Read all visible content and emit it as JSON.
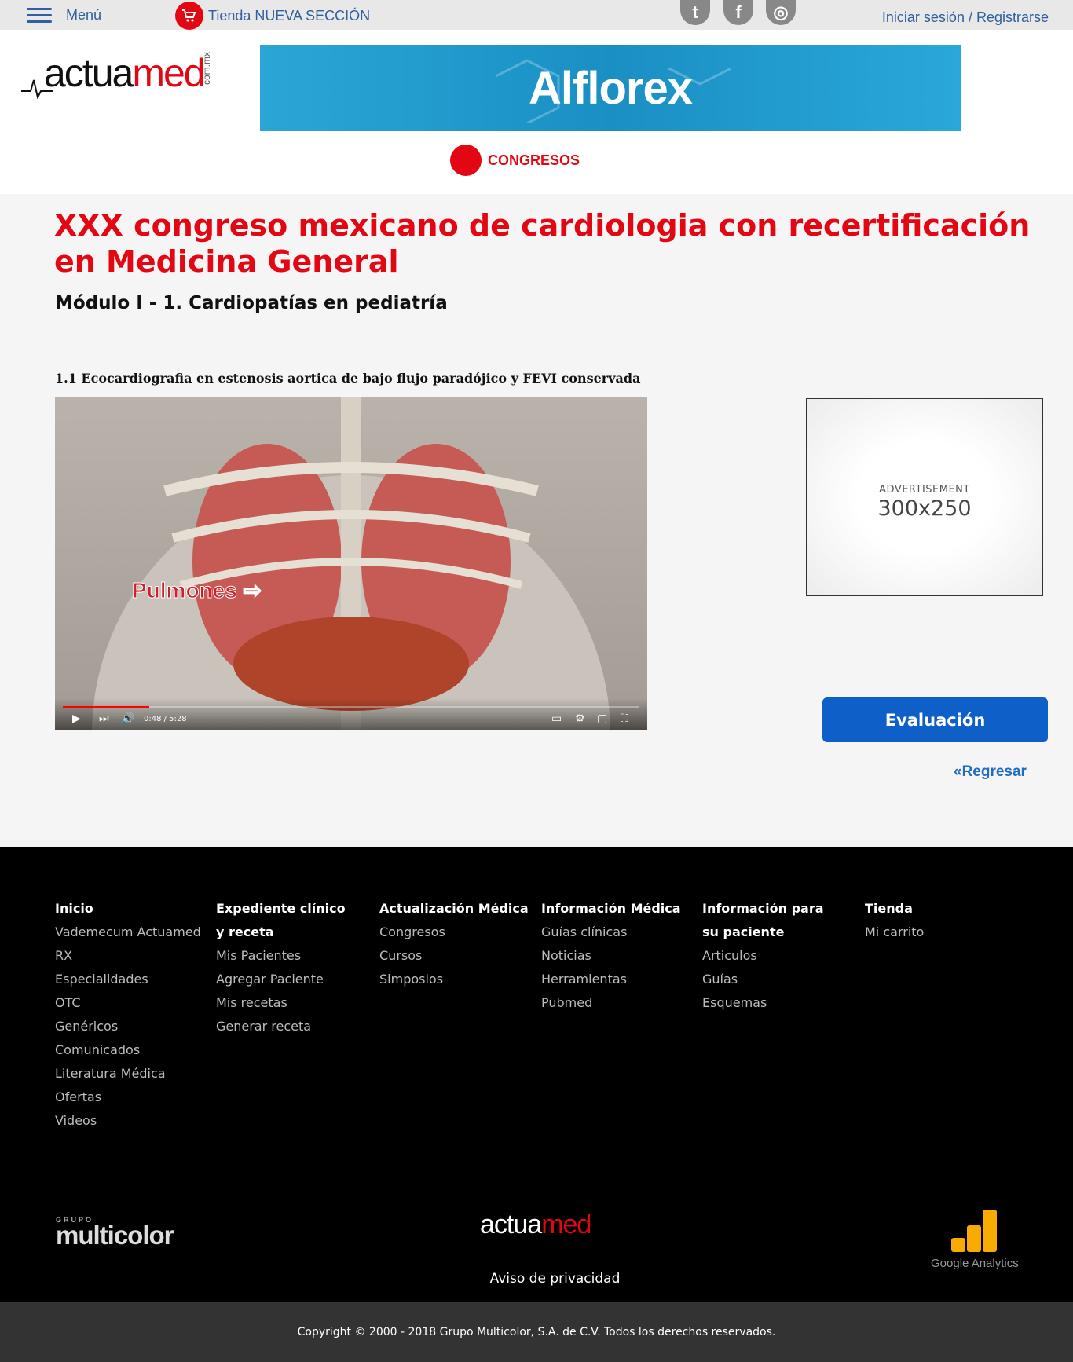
{
  "topbar": {
    "menu_label": "Menú",
    "store_label": "Tienda NUEVA SECCIÓN",
    "social": [
      {
        "icon": "twitter-icon",
        "glyph": "t"
      },
      {
        "icon": "facebook-icon",
        "glyph": "f"
      },
      {
        "icon": "instagram-icon",
        "glyph": "◎"
      }
    ],
    "login_label": "Iniciar sesión / Registrarse"
  },
  "header": {
    "logo_text_a": "actua",
    "logo_text_b": "med",
    "logo_domain": "com.mx",
    "banner_text": "Alflorex",
    "section_label": "CONGRESOS"
  },
  "content": {
    "title": "XXX congreso mexicano de cardiologia con recertificación en Medicina General",
    "subtitle": "Módulo I - 1. Cardiopatías en pediatría",
    "lesson": "1.1 Ecocardiografia en estenosis aortica de bajo flujo paradójico y FEVI conservada",
    "video": {
      "overlay_label": "Pulmones ⇨",
      "time": "0:48 / 5:28",
      "progress": 0.15
    },
    "ad": {
      "small": "ADVERTISEMENT",
      "big": "300x250"
    },
    "evaluation_button": "Evaluación",
    "back_link": "«Regresar"
  },
  "footer": {
    "columns": [
      {
        "head": "Inicio",
        "links": [
          "Vademecum Actuamed",
          "RX",
          "Especialidades",
          "OTC",
          "Genéricos",
          "Comunicados",
          "Literatura Médica",
          "Ofertas",
          "Videos"
        ]
      },
      {
        "head": "Expediente clínico y receta",
        "links": [
          "Mis Pacientes",
          "Agregar Paciente",
          "Mis recetas",
          "Generar receta"
        ]
      },
      {
        "head": "Actualización Médica",
        "links": [
          "Congresos",
          "Cursos",
          "Simposios"
        ]
      },
      {
        "head": "Información Médica",
        "links": [
          "Guías clínicas",
          "Noticias",
          "Herramientas",
          "Pubmed"
        ]
      },
      {
        "head": "Información para su paciente",
        "links": [
          "Articulos",
          "Guías",
          "Esquemas"
        ]
      },
      {
        "head": "Tienda",
        "links": [
          "Mi carrito"
        ]
      }
    ],
    "multicolor_small": "GRUPO",
    "multicolor_big": "multicolor",
    "logo_text_a": "actua",
    "logo_text_b": "med",
    "privacy": "Aviso de privacidad",
    "analytics_label": "Google Analytics"
  },
  "copyright": "Copyright © 2000 - 2018 Grupo Multicolor, S.A. de C.V. Todos los derechos reservados."
}
